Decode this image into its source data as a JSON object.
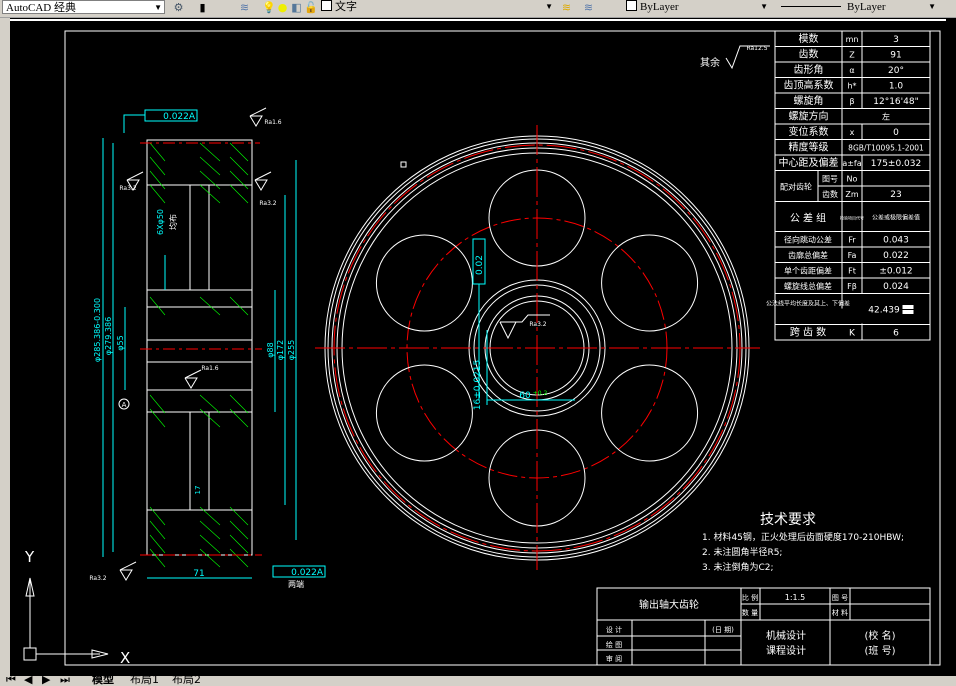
{
  "toolbar": {
    "workspace": "AutoCAD 经典",
    "layer": "文字",
    "color": "ByLayer",
    "linetype": "ByLayer"
  },
  "tabs": {
    "model": "模型",
    "layout1": "布局1",
    "layout2": "布局2"
  },
  "ucs": {
    "x": "X",
    "y": "Y"
  },
  "colors": {
    "background": "#000000",
    "lines": "#ffffff",
    "dimension": "#00ffff",
    "centerline": "#ff0000",
    "hatch": "#00ff00"
  },
  "roughness": {
    "other_label": "其余",
    "other": "Ra12.5",
    "ra16": "Ra1.6",
    "ra32": "Ra3.2"
  },
  "side_view": {
    "tol_top": "0.022",
    "datum": "A",
    "tol_bottom": "0.022",
    "both_ends": "两端",
    "width": "71",
    "holes": "6Xφ50",
    "even": "均布",
    "d1": "φ285.386-0.300",
    "d2": "φ279.386",
    "d3": "φ55",
    "d4": "φ88",
    "d5": "φ172",
    "d6": "φ255",
    "web": "17"
  },
  "front_view": {
    "sym_tol": "0.02",
    "datum": "A",
    "key_width": "16±0.0215",
    "key_depth": "60",
    "key_dev": "+0.2"
  },
  "param_table": [
    [
      "模数",
      "mn",
      "3"
    ],
    [
      "齿数",
      "Z",
      "91"
    ],
    [
      "齿形角",
      "α",
      "20°"
    ],
    [
      "齿顶高系数",
      "h*",
      "1.0"
    ],
    [
      "螺旋角",
      "β",
      "12°16'48\""
    ],
    [
      "螺旋方向",
      "",
      "左"
    ],
    [
      "变位系数",
      "x",
      "0"
    ],
    [
      "精度等级",
      "",
      "8GB/T10095.1-2001"
    ],
    [
      "中心距及偏差",
      "a±fa",
      "175±0.032"
    ]
  ],
  "pair_gear": {
    "label": "配对齿轮",
    "r1": [
      "图号",
      "No",
      ""
    ],
    "r2": [
      "齿数",
      "Zm",
      "23"
    ]
  },
  "tol_table": {
    "header": [
      "公 差 组",
      "检验项目代号",
      "公差或极限偏差值"
    ],
    "rows": [
      [
        "径向跳动公差",
        "Fr",
        "0.043"
      ],
      [
        "齿廓总偏差",
        "Fa",
        "0.022"
      ],
      [
        "单个齿距偏差",
        "Ft",
        "±0.012"
      ],
      [
        "螺旋线总偏差",
        "Fβ",
        "0.024"
      ]
    ],
    "wk_label": "公法线平均长度及其上、下偏差",
    "wk": "42.439",
    "k_label": "跨 齿 数",
    "k": "K",
    "k_val": "6"
  },
  "tech": {
    "title": "技术要求",
    "items": [
      "1. 材料45钢，正火处理后齿面硬度170-210HBW;",
      "2. 未注圆角半径R5;",
      "3. 未注倒角为C2;"
    ]
  },
  "title_block": {
    "name": "输出轴大齿轮",
    "scale_label": "比 例",
    "scale": "1:1.5",
    "drawing_no": "图 号",
    "qty": "数 量",
    "material": "材 料",
    "design": "设 计",
    "draw": "绘 图",
    "review": "审 阅",
    "date": "(日 期)",
    "course1": "机械设计",
    "course2": "课程设计",
    "school": "(校 名)",
    "class": "(班 号)"
  }
}
